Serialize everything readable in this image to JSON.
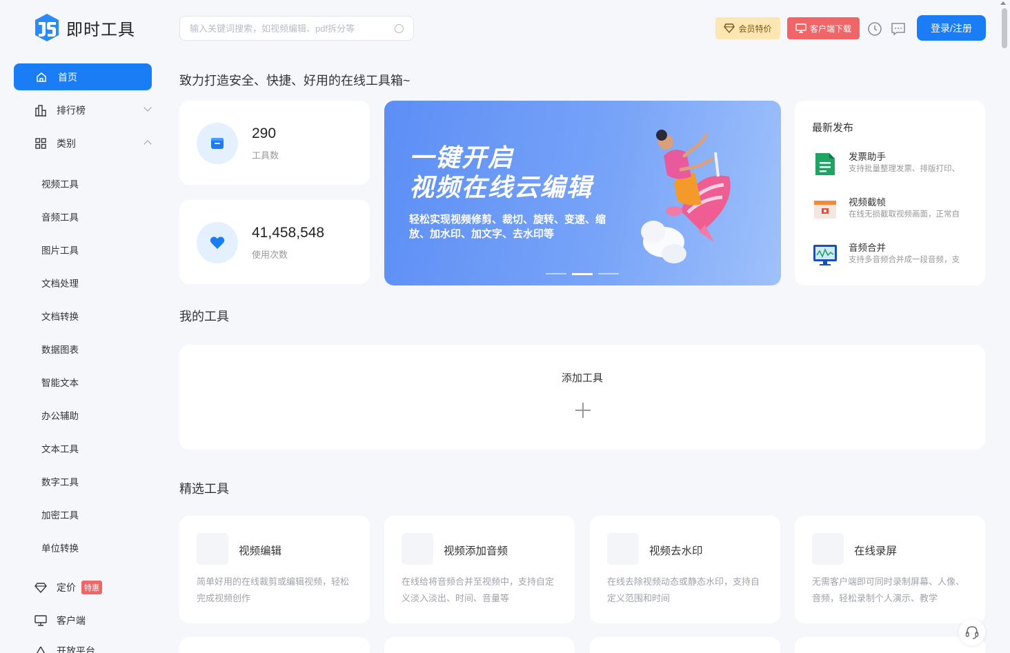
{
  "brand": {
    "name": "即时工具",
    "primary": "#1a7df5"
  },
  "search": {
    "placeholder": "输入关键词搜索，如视频编辑、pdf拆分等"
  },
  "header": {
    "vip_label": "会员特价",
    "client_label": "客户端下载",
    "login_label": "登录/注册"
  },
  "sidebar": {
    "home": "首页",
    "ranking": "排行榜",
    "category": "类别",
    "sub_items": [
      "视频工具",
      "音频工具",
      "图片工具",
      "文档处理",
      "文档转换",
      "数据图表",
      "智能文本",
      "办公辅助",
      "文本工具",
      "数字工具",
      "加密工具",
      "单位转换"
    ],
    "pricing": "定价",
    "pricing_badge": "特惠",
    "client": "客户端",
    "open_platform": "开放平台"
  },
  "main": {
    "title": "致力打造安全、快捷、好用的在线工具箱~",
    "stats": [
      {
        "value": "290",
        "label": "工具数"
      },
      {
        "value": "41,458,548",
        "label": "使用次数"
      }
    ],
    "banner": {
      "title_line1": "一键开启",
      "title_line2": "视频在线云编辑",
      "subtitle": "轻松实现视频修剪、裁切、旋转、变速、缩放、加水印、加文字、去水印等"
    },
    "latest": {
      "title": "最新发布",
      "items": [
        {
          "name": "发票助手",
          "desc": "支持批量整理发票、排版打印、"
        },
        {
          "name": "视频截帧",
          "desc": "在线无损截取视频画面，正常自"
        },
        {
          "name": "音频合并",
          "desc": "支持多音频合并成一段音频，支"
        }
      ]
    },
    "my_tools": {
      "title": "我的工具",
      "add_label": "添加工具"
    },
    "featured": {
      "title": "精选工具",
      "tools": [
        {
          "name": "视频编辑",
          "desc": "简单好用的在线裁剪或编辑视频，轻松完成视频创作"
        },
        {
          "name": "视频添加音频",
          "desc": "在线给将音频合并至视频中，支持自定义淡入淡出、时间、音量等"
        },
        {
          "name": "视频去水印",
          "desc": "在线去除视频动态或静态水印，支持自定义范围和时间"
        },
        {
          "name": "在线录屏",
          "desc": "无需客户端即可同时录制屏幕、人像、音频，轻松录制个人演示、教学"
        }
      ]
    }
  }
}
